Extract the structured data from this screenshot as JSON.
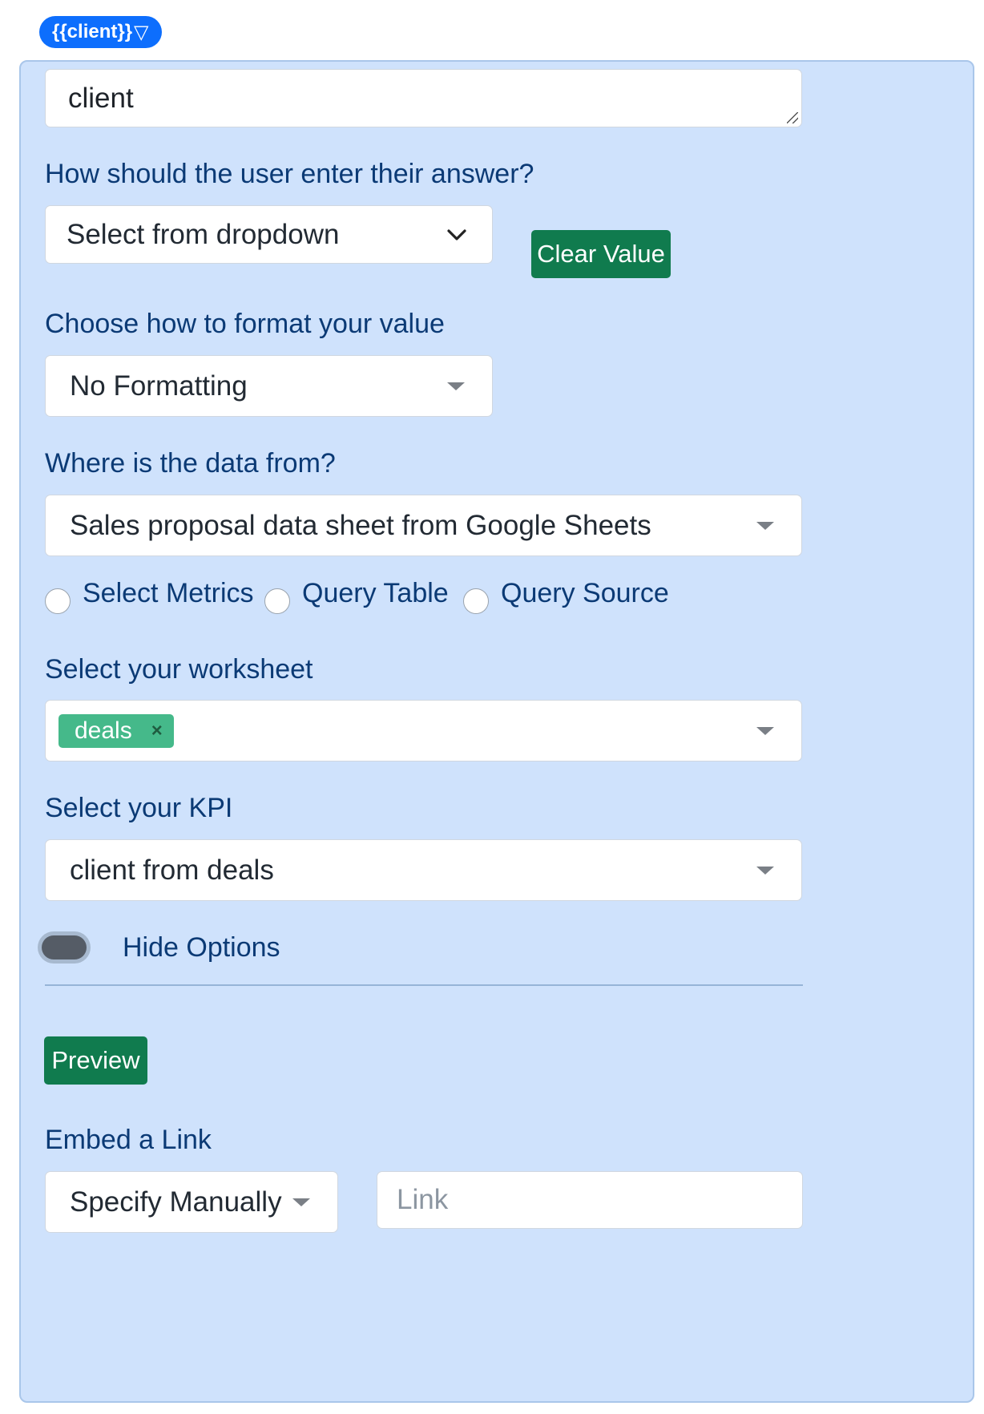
{
  "tag": {
    "label": "{{client}}",
    "caret": "▽"
  },
  "variable": {
    "value": "client"
  },
  "input_method": {
    "label": "How should the user enter their answer?",
    "selected": "Select from dropdown",
    "clear_button": "Clear Value"
  },
  "format": {
    "label": "Choose how to format your value",
    "selected": "No Formatting"
  },
  "data_source": {
    "label": "Where is the data from?",
    "selected": "Sales proposal data sheet from Google Sheets"
  },
  "mode_radios": [
    {
      "label": "Select Metrics",
      "checked": false
    },
    {
      "label": "Query Table",
      "checked": false
    },
    {
      "label": "Query Source",
      "checked": false
    }
  ],
  "worksheet": {
    "label": "Select your worksheet",
    "chips": [
      {
        "label": "deals",
        "remove": "×"
      }
    ]
  },
  "kpi": {
    "label": "Select your KPI",
    "selected": "client from deals"
  },
  "options_toggle": {
    "label": "Hide Options"
  },
  "preview_button": "Preview",
  "embed": {
    "label": "Embed a Link",
    "mode_selected": "Specify Manually",
    "link_placeholder": "Link"
  },
  "colors": {
    "panel_bg": "#cfe2fc",
    "accent_blue": "#0d6efd",
    "button_green": "#107b4e",
    "chip_green": "#45b98a",
    "label_text": "#0b3a75"
  }
}
